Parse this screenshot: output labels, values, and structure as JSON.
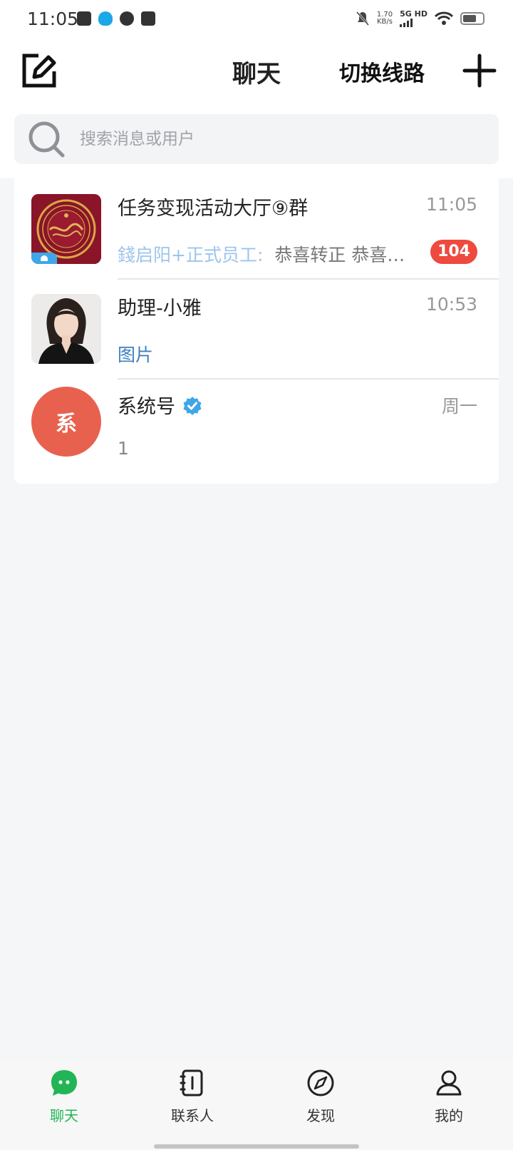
{
  "status_bar": {
    "time": "11:05",
    "net_speed_value": "1.70",
    "net_speed_unit": "KB/s",
    "net_type": "5G HD",
    "icons": [
      "app-icon",
      "qq-icon",
      "message-icon",
      "store-icon",
      "mute-icon",
      "signal-icon",
      "wifi-icon",
      "battery-icon"
    ]
  },
  "header": {
    "title": "聊天",
    "switch_line_label": "切换线路",
    "compose_icon": "compose-icon",
    "add_icon": "plus-icon"
  },
  "search": {
    "placeholder": "搜索消息或用户"
  },
  "chats": [
    {
      "name": "任务变现活动大厅⑨群",
      "time": "11:05",
      "preview_sender": "錢启阳+正式员工:",
      "preview_text": "恭喜转正    恭喜…",
      "unread": "104",
      "is_group": true
    },
    {
      "name": "助理-小雅",
      "time": "10:53",
      "preview_text": "图片"
    },
    {
      "name": "系统号",
      "avatar_text": "系",
      "time": "周一",
      "preview_text": "1",
      "verified": true
    }
  ],
  "colors": {
    "accent_green": "#21b556",
    "badge_red": "#ee4a3f",
    "link_blue": "#4a8fd6",
    "system_avatar": "#e8614f",
    "verified_blue": "#3fa6e9"
  },
  "bottom_nav": [
    {
      "label": "聊天",
      "icon": "chat-bubble-icon",
      "active": true
    },
    {
      "label": "联系人",
      "icon": "contacts-book-icon",
      "active": false
    },
    {
      "label": "发现",
      "icon": "compass-icon",
      "active": false
    },
    {
      "label": "我的",
      "icon": "user-profile-icon",
      "active": false
    }
  ]
}
